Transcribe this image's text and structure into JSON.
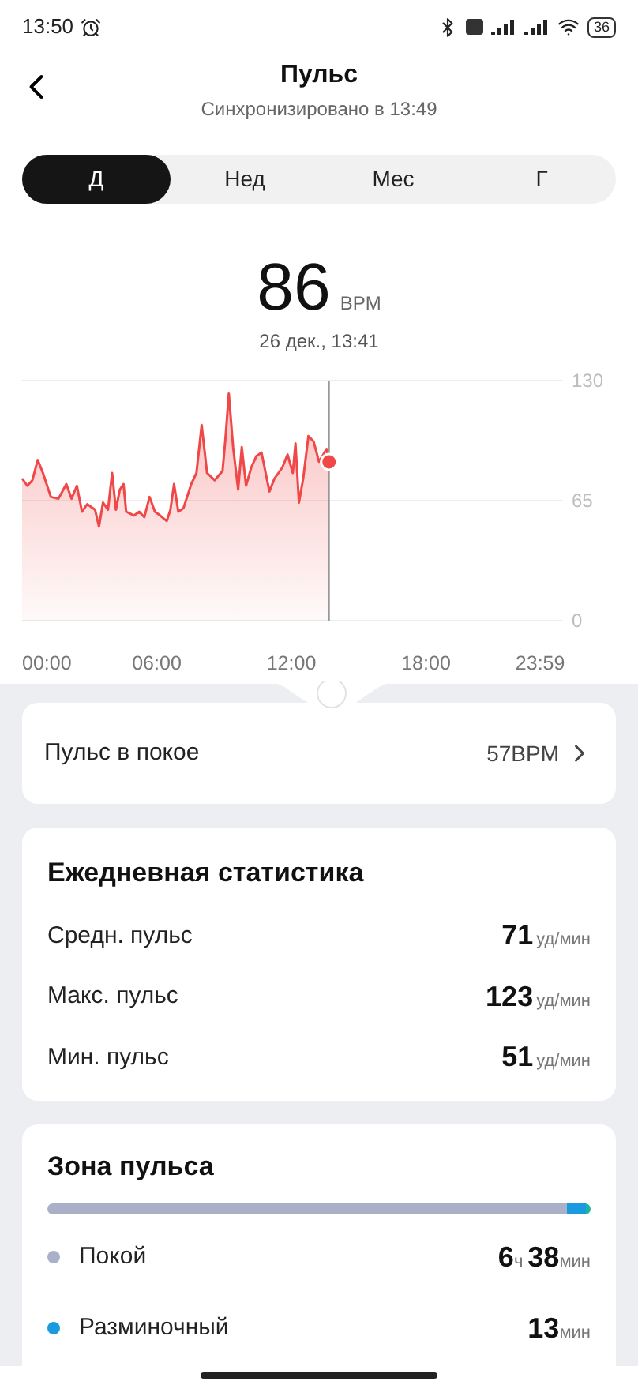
{
  "status_bar": {
    "time": "13:50",
    "battery": "36"
  },
  "header": {
    "title": "Пульс",
    "subtitle": "Синхронизировано в 13:49"
  },
  "tabs": [
    {
      "label": "Д",
      "selected": true
    },
    {
      "label": "Нед",
      "selected": false
    },
    {
      "label": "Мес",
      "selected": false
    },
    {
      "label": "Г",
      "selected": false
    }
  ],
  "reading": {
    "value": "86",
    "unit": "BPM",
    "time": "26 дек., 13:41"
  },
  "chart_data": {
    "type": "area",
    "xlim": [
      0,
      24
    ],
    "ylim": [
      0,
      130
    ],
    "yticks": [
      0,
      65,
      130
    ],
    "xticks": [
      {
        "value": 0,
        "label": "00:00"
      },
      {
        "value": 6,
        "label": "06:00"
      },
      {
        "value": 12,
        "label": "12:00"
      },
      {
        "value": 18,
        "label": "18:00"
      },
      {
        "value": 23.98,
        "label": "23:59"
      }
    ],
    "x": [
      0,
      0.23,
      0.46,
      0.7,
      0.93,
      1.28,
      1.62,
      1.97,
      2.2,
      2.44,
      2.67,
      2.9,
      3.25,
      3.43,
      3.6,
      3.83,
      4.01,
      4.18,
      4.36,
      4.52,
      4.64,
      4.99,
      5.22,
      5.45,
      5.68,
      5.92,
      6.15,
      6.45,
      6.61,
      6.77,
      6.96,
      7.19,
      7.54,
      7.77,
      8,
      8.24,
      8.58,
      8.93,
      9.05,
      9.21,
      9.4,
      9.63,
      9.79,
      9.98,
      10.21,
      10.44,
      10.67,
      11.02,
      11.25,
      11.6,
      11.83,
      12.06,
      12.18,
      12.34,
      12.53,
      12.76,
      12.99,
      13.23,
      13.57,
      13.68
    ],
    "ref_lines": [
      {
        "axis": "x",
        "value": 13.68
      }
    ],
    "series": [
      {
        "color": "#f04848",
        "values": [
          77,
          73,
          76,
          87,
          80,
          67,
          66,
          74,
          66,
          73,
          59,
          63,
          60,
          51,
          64,
          60,
          80,
          60,
          71,
          74,
          59,
          57,
          59,
          56,
          67,
          59,
          57,
          54,
          60,
          74,
          59,
          61,
          74,
          80,
          106,
          80,
          76,
          81,
          97,
          123,
          94,
          71,
          94,
          73,
          83,
          89,
          91,
          70,
          77,
          83,
          90,
          80,
          96,
          64,
          77,
          100,
          97,
          86,
          93,
          86
        ]
      }
    ]
  },
  "resting": {
    "label": "Пульс в покое",
    "value": "57BPM"
  },
  "daily": {
    "title": "Ежедневная статистика",
    "rows": [
      {
        "label": "Средн. пульс",
        "value": "71",
        "unit": "уд/мин"
      },
      {
        "label": "Макс. пульс",
        "value": "123",
        "unit": "уд/мин"
      },
      {
        "label": "Мин. пульс",
        "value": "51",
        "unit": "уд/мин"
      }
    ]
  },
  "zones": {
    "title": "Зона пульса",
    "bar": [
      {
        "color": "#aab0c8"
      },
      {
        "color": "#1a9be0"
      },
      {
        "color": "#1fb5a5"
      }
    ],
    "items": [
      {
        "label": "Покой",
        "color": "#aab0c8",
        "parts": [
          {
            "num": "6",
            "unit": "ч"
          },
          {
            "num": "38",
            "unit": "мин"
          }
        ]
      },
      {
        "label": "Разминочный",
        "color": "#1a9be0",
        "parts": [
          {
            "num": "13",
            "unit": "мин"
          }
        ]
      }
    ]
  }
}
